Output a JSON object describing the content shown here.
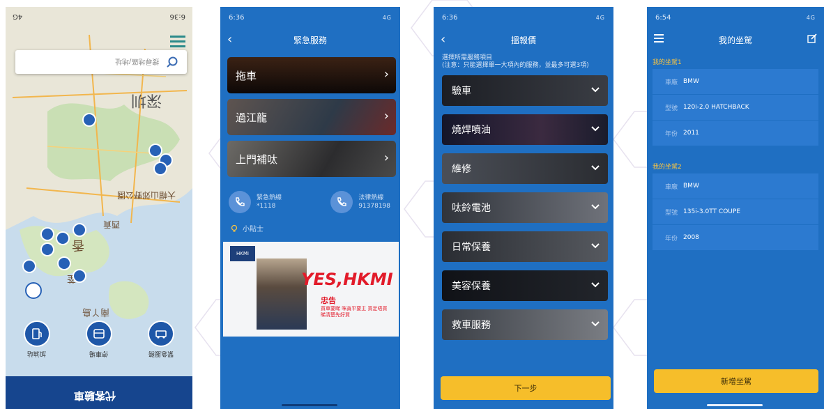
{
  "phone1": {
    "status_time": "6:36",
    "status_net": "4G",
    "search_placeholder": "搜尋地區/地址",
    "map_labels": {
      "shenzhen": "深圳",
      "hongkong": "香",
      "lantau": "南丫島",
      "tsuen": "荃",
      "park": "大帽山郊野公園",
      "sai": "西貢"
    },
    "bottom_labels": [
      "加油站",
      "停車場",
      "緊急服務"
    ],
    "banner_title": "代客驗車"
  },
  "phone2": {
    "status_time": "6:36",
    "status_net": "4G",
    "title": "緊急服務",
    "services": [
      "拖車",
      "過江龍",
      "上門補呔"
    ],
    "hotline1_label": "緊急熱線",
    "hotline1_number": "*1118",
    "hotline2_label": "法律熱線",
    "hotline2_number": "91378198",
    "tips_label": "小貼士",
    "ad_logo": "HKMI",
    "ad_headline": "YES,HKMI",
    "ad_sub": "忠告",
    "ad_line": "買車要睇 咪貪平要主 買定唔買 睇清楚先好買"
  },
  "phone3": {
    "status_time": "6:36",
    "status_net": "4G",
    "title": "搵報價",
    "instructions": "選擇所需服務項目\n(注意：只能選擇單一大項內的服務，並最多可選3項)",
    "options": [
      "驗車",
      "燒焊噴油",
      "維修",
      "呔鈴電池",
      "日常保養",
      "美容保養",
      "救車服務"
    ],
    "next_label": "下一步"
  },
  "phone4": {
    "status_time": "6:54",
    "status_net": "4G",
    "title": "我的坐駕",
    "car1_section": "我的坐駕1",
    "car1": [
      {
        "k": "車廠",
        "v": "BMW"
      },
      {
        "k": "型號",
        "v": "120i-2.0 HATCHBACK"
      },
      {
        "k": "年份",
        "v": "2011"
      }
    ],
    "car2_section": "我的坐駕2",
    "car2": [
      {
        "k": "車廠",
        "v": "BMW"
      },
      {
        "k": "型號",
        "v": "135i-3.0TT COUPE"
      },
      {
        "k": "年份",
        "v": "2008"
      }
    ],
    "add_label": "新增坐駕"
  },
  "colors": {
    "brand_blue": "#1f6fc2",
    "accent_yellow": "#f6be2a",
    "section_yellow": "#f6c344"
  }
}
